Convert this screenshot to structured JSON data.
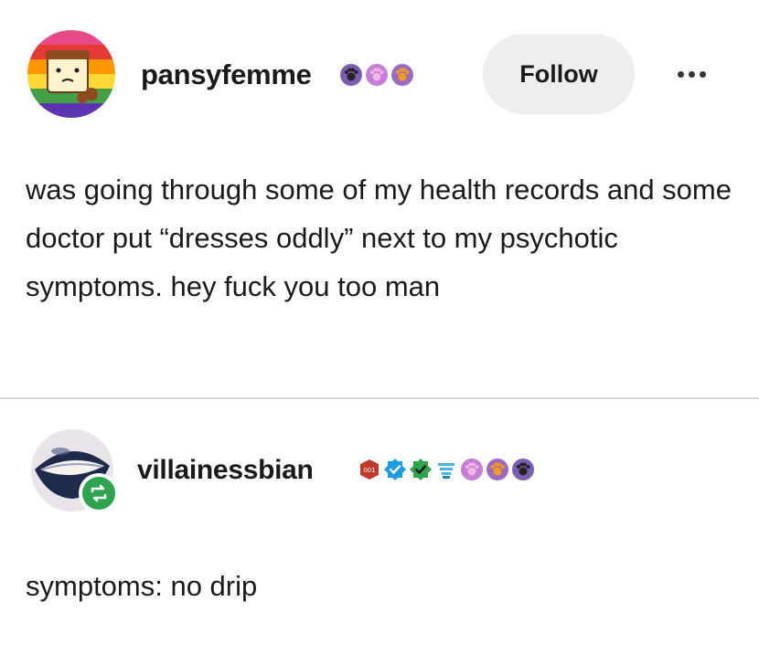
{
  "post": {
    "username": "pansyfemme",
    "follow_label": "Follow",
    "more_label": "•••",
    "body": "was going through some of my health records and some doctor put “dresses oddly” next to my psychotic symptoms. hey fuck you too man",
    "badges": [
      "paw-badge-icon",
      "paw-badge-icon",
      "paw-badge-icon"
    ]
  },
  "reblog": {
    "username": "villainessbian",
    "body": "symptoms: no drip",
    "badges": [
      "mushroom-badge-icon",
      "verified-badge-icon",
      "checkmark-badge-icon",
      "bunny-badge-icon",
      "paw-badge-icon",
      "paw-badge-icon",
      "paw-badge-icon"
    ]
  },
  "colors": {
    "text": "#1a1a1a",
    "follow_bg": "#eeeeee",
    "divider": "#d8d8d8",
    "reblog_green": "#2ea44f",
    "verified_blue": "#1e9be8"
  }
}
